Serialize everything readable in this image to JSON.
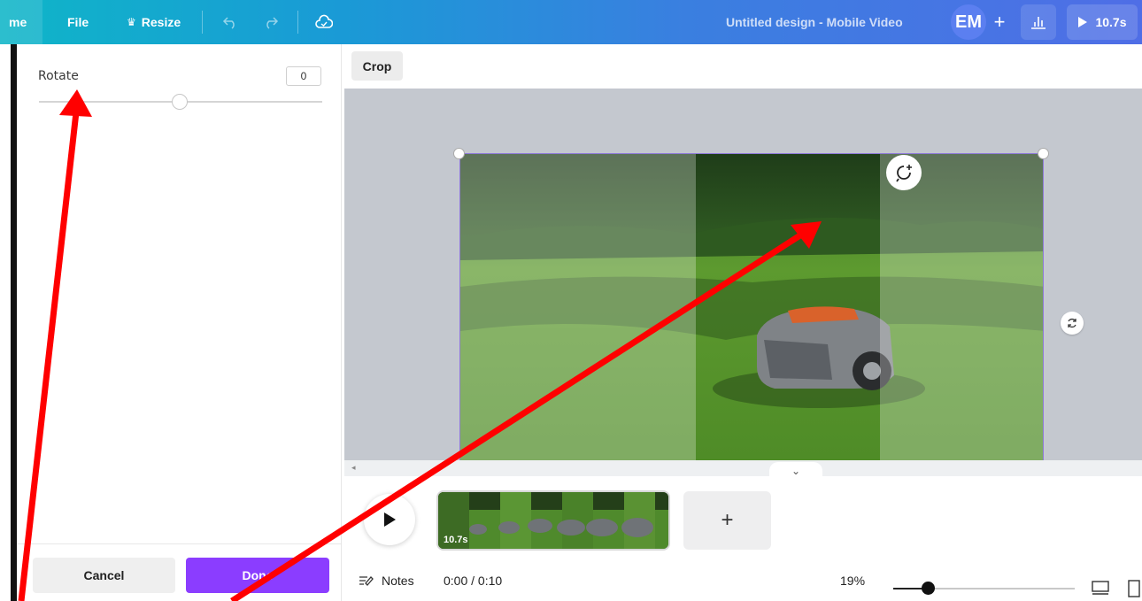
{
  "topbar": {
    "home_label": "me",
    "file_label": "File",
    "resize_label": "Resize",
    "design_title": "Untitled design - Mobile Video",
    "avatar_initials": "EM",
    "share_plus": "+",
    "play_duration": "10.7s",
    "icons": {
      "resize": "crown-icon",
      "undo": "undo-icon",
      "redo": "redo-icon",
      "save": "cloud-save-icon",
      "insights": "bar-chart-icon",
      "play": "play-icon"
    }
  },
  "panel": {
    "rotate_label": "Rotate",
    "rotate_value": "0",
    "cancel_label": "Cancel",
    "done_label": "Done"
  },
  "editor": {
    "crop_label": "Crop"
  },
  "timeline": {
    "clip_duration": "10.7s",
    "add_label": "+"
  },
  "statusbar": {
    "notes_label": "Notes",
    "timecode": "0:00 / 0:10",
    "zoom_percent": "19%",
    "zoom_level": 0.19
  },
  "colors": {
    "accent_purple": "#8b3dff",
    "annotation_red": "#ff0000",
    "selection_border": "#8f7ad8"
  }
}
